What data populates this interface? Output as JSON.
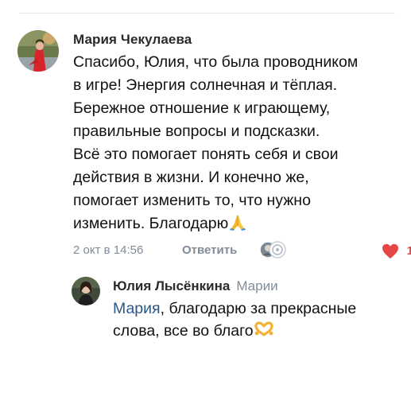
{
  "comment": {
    "author": "Мария Чекулаева",
    "text": "Спасибо, Юлия, что была проводником\nв игре! Энергия солнечная и тёплая.\nБережное отношение к играющему,\nправильные вопросы и подсказки.\nВсё это помогает понять себя и свои\nдействия в жизни. И конечно же,\nпомогает изменить то, что нужно\nизменить. Благодарю",
    "emoji": "folded-hands-emoji",
    "date": "2 окт в 14:56",
    "reply_label": "Ответить",
    "likes": "1",
    "like_color": "#e64646"
  },
  "reply": {
    "author": "Юлия Лысёнкина",
    "reply_to": "Марии",
    "mention": "Мария",
    "text": ", благодарю за прекрасные слова, все во благо",
    "emoji": "heart-hands-emoji",
    "mention_color": "#2a5885"
  }
}
